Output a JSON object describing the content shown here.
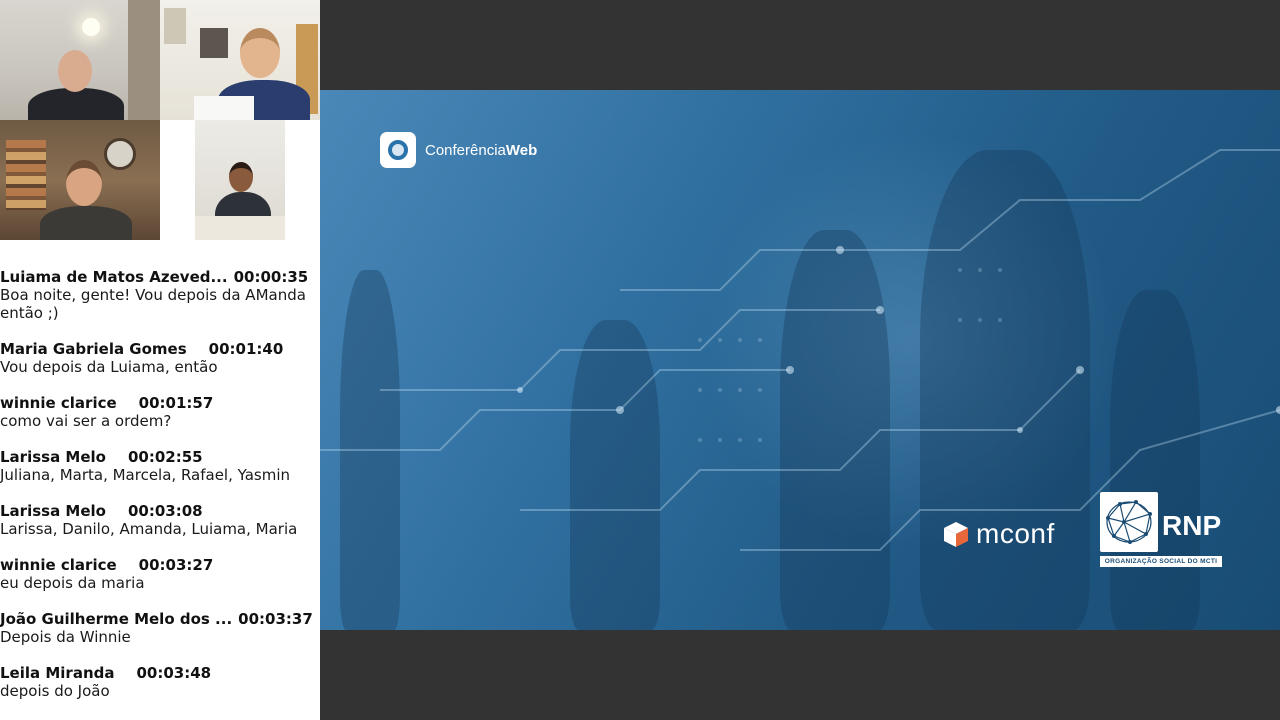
{
  "chat": {
    "messages": [
      {
        "author": "Luiama de Matos Azeved...",
        "time": "00:00:35",
        "text": "Boa noite, gente! Vou depois da AManda então ;)"
      },
      {
        "author": "Maria Gabriela Gomes",
        "time": "00:01:40",
        "text": "Vou depois da Luiama, então"
      },
      {
        "author": "winnie clarice",
        "time": "00:01:57",
        "text": "como vai ser a ordem?"
      },
      {
        "author": "Larissa Melo",
        "time": "00:02:55",
        "text": "Juliana, Marta, Marcela, Rafael, Yasmin"
      },
      {
        "author": "Larissa Melo",
        "time": "00:03:08",
        "text": "Larissa, Danilo, Amanda, Luiama, Maria"
      },
      {
        "author": "winnie clarice",
        "time": "00:03:27",
        "text": "eu depois da maria"
      },
      {
        "author": "João Guilherme Melo dos ...",
        "time": "00:03:37",
        "text": "Depois da Winnie"
      },
      {
        "author": "Leila Miranda",
        "time": "00:03:48",
        "text": "depois do João"
      }
    ]
  },
  "slide": {
    "brand_prefix": "Conferência",
    "brand_suffix": "Web",
    "mconf_label": "mconf",
    "rnp_label": "RNP",
    "rnp_subtitle": "ORGANIZAÇÃO SOCIAL DO MCTI"
  },
  "colors": {
    "slide_blue": "#2f6f9f",
    "presentation_bg": "#333333",
    "mconf_orange": "#e8673a"
  }
}
